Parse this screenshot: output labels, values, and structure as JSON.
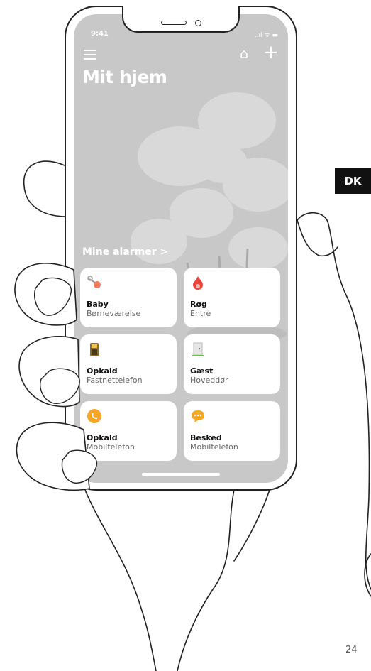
{
  "language_tab": "DK",
  "page_number": "24",
  "status": {
    "time": "9:41",
    "icons": "..ıl ᯤ ▬"
  },
  "header": {
    "title": "Mit hjem",
    "home_icon": "⌂",
    "add_icon": "+"
  },
  "section_title": "Mine alarmer >",
  "alarms": [
    {
      "name": "Baby",
      "location": "Børneværelse",
      "icon": "pacifier-icon",
      "color": "#f07a5a"
    },
    {
      "name": "Røg",
      "location": "Entré",
      "icon": "flame-icon",
      "color": "#e8453c"
    },
    {
      "name": "Opkald",
      "location": "Fastnettelefon",
      "icon": "landline-phone-icon",
      "color": "#8a6a2a"
    },
    {
      "name": "Gæst",
      "location": "Hoveddør",
      "icon": "door-icon",
      "color": "#6cc04a"
    },
    {
      "name": "Opkald",
      "location": "Mobiltelefon",
      "icon": "mobile-call-icon",
      "color": "#f5a623"
    },
    {
      "name": "Besked",
      "location": "Mobiltelefon",
      "icon": "message-icon",
      "color": "#f5a623"
    }
  ]
}
